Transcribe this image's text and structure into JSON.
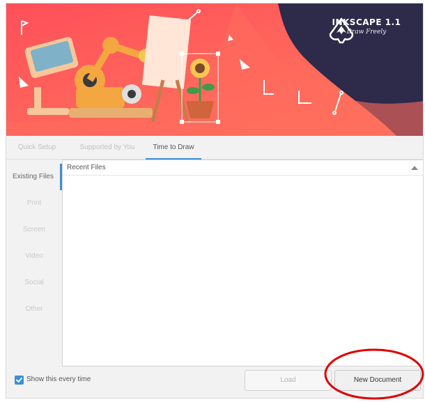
{
  "banner": {
    "app_name": "INKSCAPE 1.1",
    "tagline": "Draw Freely",
    "colors": {
      "background": "#ff5a52",
      "gradient_end": "#ff7a5c",
      "dark_wave": "#2d2a4a"
    }
  },
  "tabs": [
    {
      "label": "Quick Setup",
      "active": false
    },
    {
      "label": "Supported by You",
      "active": false
    },
    {
      "label": "Time to Draw",
      "active": true
    }
  ],
  "sidebar": {
    "items": [
      {
        "label": "Existing Files",
        "active": true
      },
      {
        "label": "Print",
        "active": false
      },
      {
        "label": "Screen",
        "active": false
      },
      {
        "label": "Video",
        "active": false
      },
      {
        "label": "Social",
        "active": false
      },
      {
        "label": "Other",
        "active": false
      }
    ]
  },
  "recent_files": {
    "header": "Recent Files",
    "rows": []
  },
  "footer": {
    "show_every_time_label": "Show this every time",
    "show_every_time_checked": true,
    "load_label": "Load",
    "new_document_label": "New Document"
  },
  "colors": {
    "accent": "#3c8fd8",
    "annotation": "#e00000"
  }
}
